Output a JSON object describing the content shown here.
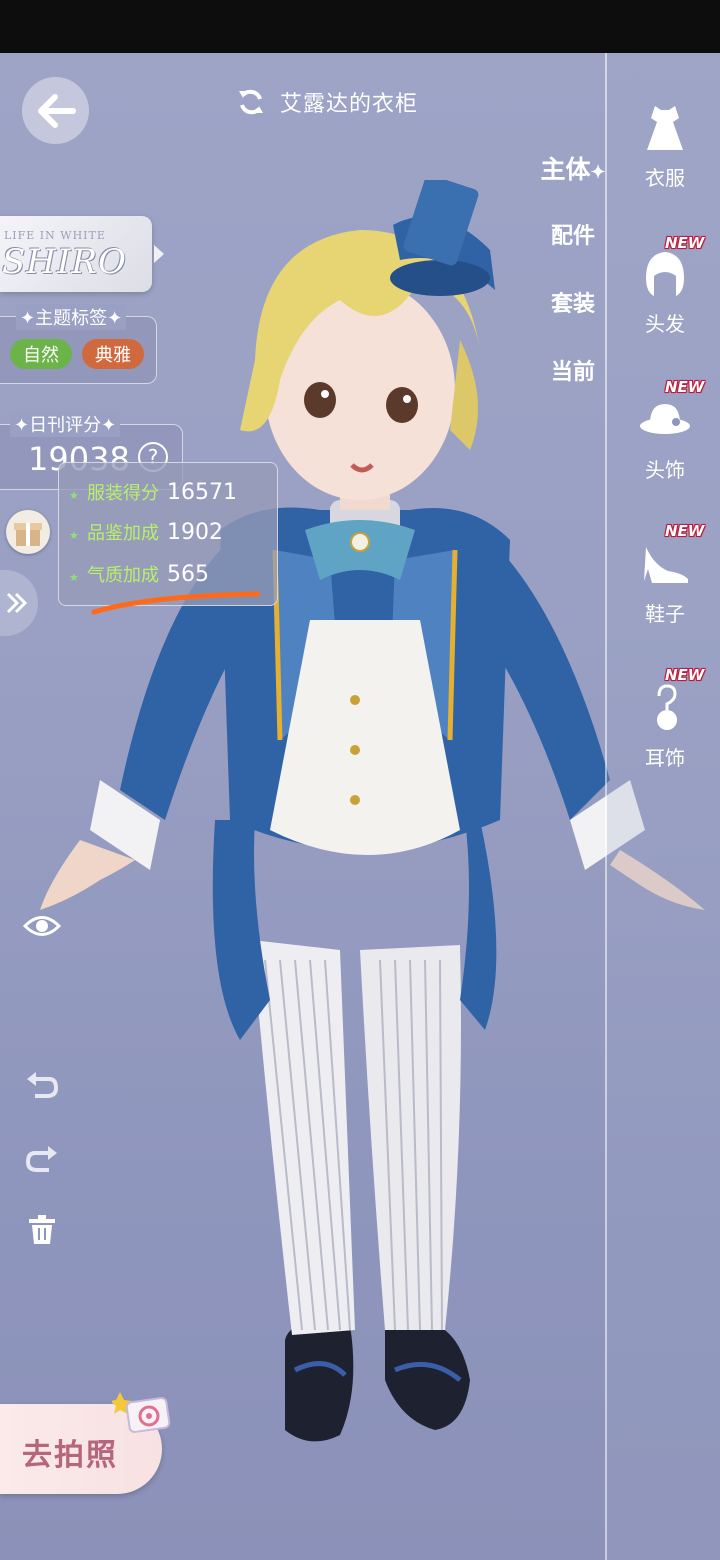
{
  "header": {
    "title": "艾露达的衣柜"
  },
  "tabs": [
    {
      "label": "主体",
      "active": true
    },
    {
      "label": "配件",
      "active": false
    },
    {
      "label": "套装",
      "active": false
    },
    {
      "label": "当前",
      "active": false
    }
  ],
  "categories": [
    {
      "label": "衣服",
      "icon": "dress-icon",
      "new": false
    },
    {
      "label": "头发",
      "icon": "hair-icon",
      "new": true
    },
    {
      "label": "头饰",
      "icon": "hat-icon",
      "new": true
    },
    {
      "label": "鞋子",
      "icon": "shoe-icon",
      "new": true
    },
    {
      "label": "耳饰",
      "icon": "earring-icon",
      "new": true
    }
  ],
  "new_badge": "NEW",
  "theme_card": {
    "small": "LIFE IN WHITE",
    "big": "SHIRO"
  },
  "theme_tags": {
    "title": "主题标签",
    "tags": [
      "自然",
      "典雅"
    ]
  },
  "daily_score": {
    "title": "日刊评分",
    "value": "19038",
    "help": "?"
  },
  "score_breakdown": [
    {
      "label": "服装得分",
      "value": "16571"
    },
    {
      "label": "品鉴加成",
      "value": "1902"
    },
    {
      "label": "气质加成",
      "value": "565"
    }
  ],
  "photo_button": {
    "label": "去拍照"
  },
  "colors": {
    "accent_green": "#6cb349",
    "accent_orange": "#d06a3e",
    "underline": "#ff6a1a",
    "new_red": "#c0193a"
  }
}
